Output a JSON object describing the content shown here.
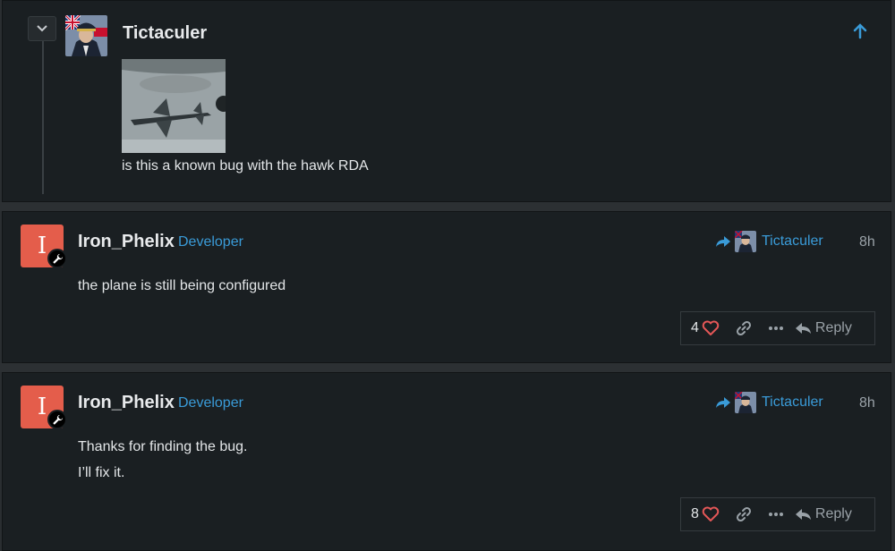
{
  "quote": {
    "username": "Tictaculer",
    "text": "is this a known bug with the hawk RDA"
  },
  "posts": [
    {
      "avatar_letter": "I",
      "username": "Iron_Phelix",
      "title": "Developer",
      "reply_to": "Tictaculer",
      "date": "8h",
      "body": [
        "the plane is still being configured"
      ],
      "likes": "4",
      "reply_label": "Reply"
    },
    {
      "avatar_letter": "I",
      "username": "Iron_Phelix",
      "title": "Developer",
      "reply_to": "Tictaculer",
      "date": "8h",
      "body": [
        "Thanks for finding the bug.",
        "I’ll fix it."
      ],
      "likes": "8",
      "reply_label": "Reply"
    }
  ],
  "colors": {
    "background": "#1a1f22",
    "accent_blue": "#3a9bd8",
    "avatar_red": "#e45d4b",
    "heart_red": "#e45757"
  },
  "icons": {
    "collapse": "chevron-down-icon",
    "back_to_top": "arrow-up-icon",
    "reply_to": "share-arrow-icon",
    "like": "heart-icon",
    "link": "link-icon",
    "more": "ellipsis-icon",
    "reply": "reply-icon",
    "role": "wrench-icon"
  }
}
